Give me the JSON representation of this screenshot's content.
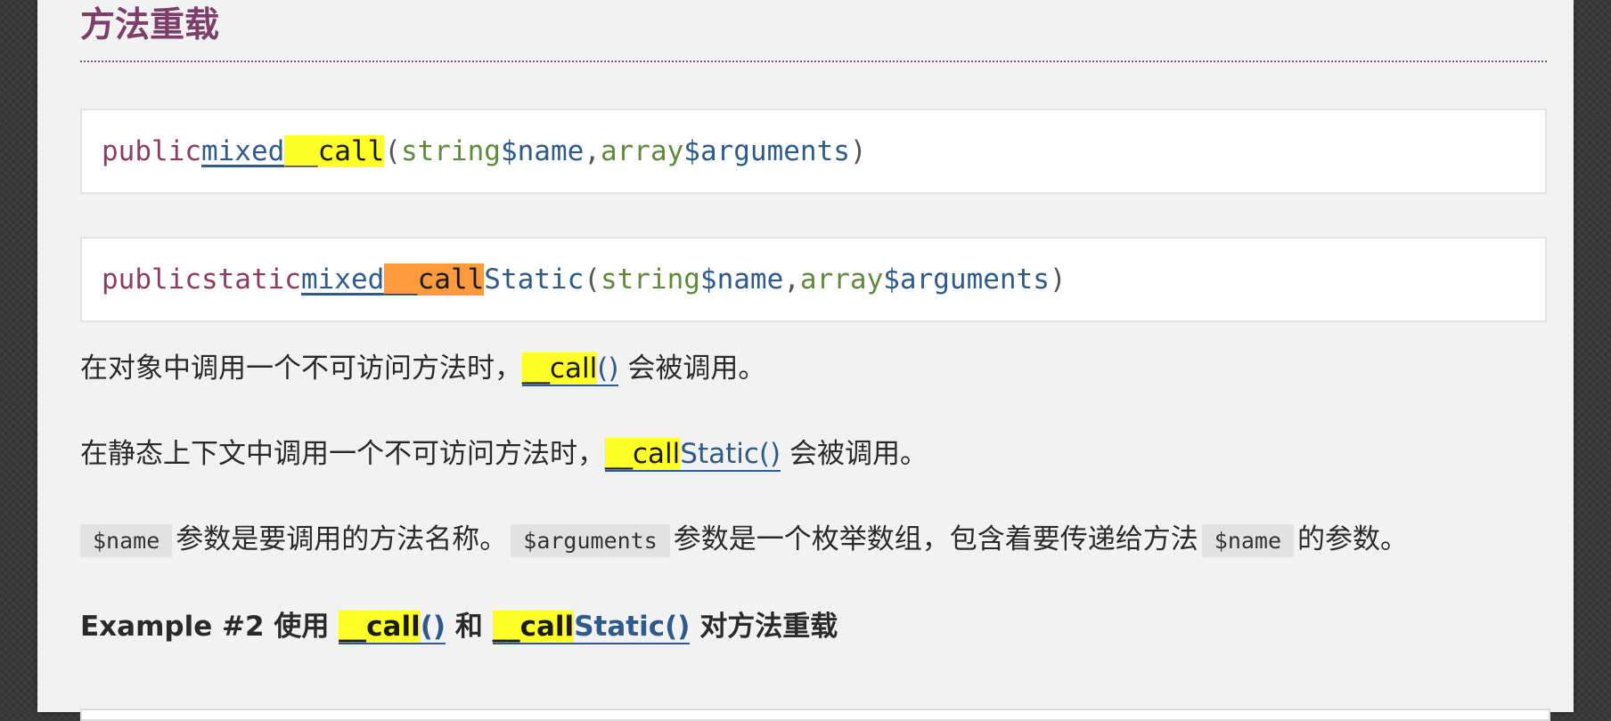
{
  "heading": "方法重载",
  "sig1": {
    "visibility": "public",
    "return_type": "mixed",
    "fname": "__call",
    "open": "(",
    "p1_type": "string",
    "p1_var": "$name",
    "comma": ",",
    "p2_type": "array",
    "p2_var": "$arguments",
    "close": ")"
  },
  "sig2": {
    "visibility": "public",
    "static_kw": "static",
    "return_type": "mixed",
    "fname_hl": "__call",
    "fname_rest": "Static",
    "open": "(",
    "p1_type": "string",
    "p1_var": "$name",
    "comma": ",",
    "p2_type": "array",
    "p2_var": "$arguments",
    "close": ")"
  },
  "para1": {
    "before": "在对象中调用一个不可访问方法时，",
    "link_hl": "__call",
    "link_rest": "()",
    "after": " 会被调用。"
  },
  "para2": {
    "before": "在静态上下文中调用一个不可访问方法时，",
    "link_hl": "__call",
    "link_rest": "Static()",
    "after": " 会被调用。"
  },
  "para3": {
    "code1": "$name",
    "text1": "参数是要调用的方法名称。",
    "code2": "$arguments",
    "text2": "参数是一个枚举数组，包含着要传递给方法",
    "code3": "$name",
    "text3": "的参数。"
  },
  "example": {
    "label": "Example #2 使用 ",
    "link1_hl": "__call",
    "link1_rest": "()",
    "mid": " 和 ",
    "link2_hl": "__call",
    "link2_rest": "Static()",
    "end": " 对方法重载"
  },
  "colors": {
    "heading": "#7b3f6a",
    "keyword": "#8d3d60",
    "type": "#2f5a8a",
    "param_type": "#5f8a3e",
    "highlight_yellow": "#ffff28",
    "highlight_orange": "#ff9a3c"
  }
}
